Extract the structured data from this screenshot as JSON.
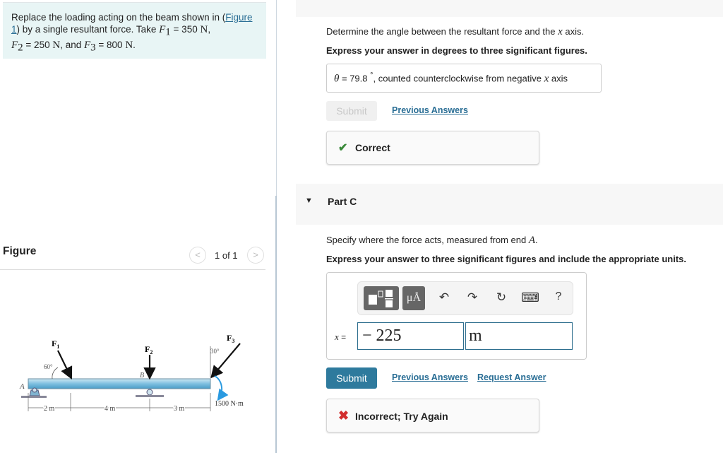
{
  "problem": {
    "text_1": "Replace the loading acting on the beam shown in (",
    "figure_link": "Figure 1",
    "text_2": ") by a single resultant force. Take ",
    "f1_sym": "F",
    "f1_sub": "1",
    "f1_val": " = 350 ",
    "f1_unit": "N",
    "sep1": ",",
    "f2_sym": "F",
    "f2_sub": "2",
    "f2_val": " = 250 ",
    "f2_unit": "N",
    "and": ", and ",
    "f3_sym": "F",
    "f3_sub": "3",
    "f3_val": " = 800 ",
    "f3_unit": "N",
    "end": "."
  },
  "figure": {
    "title": "Figure",
    "counter": "1 of 1",
    "prev_icon": "chevron-left-icon",
    "next_icon": "chevron-right-icon",
    "labels": {
      "f1": "F",
      "f1_sub": "1",
      "f2": "F",
      "f2_sub": "2",
      "f3": "F",
      "f3_sub": "3",
      "angle1": "60°",
      "angle3": "30°",
      "point_a": "A",
      "point_b": "B",
      "dim1": "2 m",
      "dim2": "4 m",
      "dim3": "3 m",
      "moment": "1500 N·m"
    }
  },
  "part_b": {
    "question_pre": "Determine the angle between the resultant force and the ",
    "question_var": "x",
    "question_post": " axis.",
    "instruction": "Express your answer in degrees to three significant figures.",
    "answer_var": "θ",
    "answer_eq": " = ",
    "answer_value": "79.8",
    "answer_deg": "°",
    "answer_suffix": ", counted counterclockwise from negative ",
    "answer_axis": "x",
    "answer_axis_post": " axis",
    "submit_label": "Submit",
    "previous_answers": "Previous Answers",
    "feedback": "Correct",
    "feedback_color": "#3a8a3a"
  },
  "part_c": {
    "label": "Part C",
    "question_pre": "Specify where the force acts, measured from end ",
    "question_var": "A",
    "question_post": ".",
    "instruction": "Express your answer to three significant figures and include the appropriate units.",
    "toolbar": {
      "templates": "templates-icon",
      "units": "μÅ",
      "undo": "↶",
      "redo": "↷",
      "reset": "↻",
      "keyboard": "⌨",
      "help": "?"
    },
    "var_label": "x",
    "var_eq": " = ",
    "value": "− 225",
    "unit": "m",
    "submit_label": "Submit",
    "previous_answers": "Previous Answers",
    "request_answer": "Request Answer",
    "feedback": "Incorrect; Try Again",
    "feedback_color": "#d22e2e",
    "submit_color": "#2e7a9d"
  }
}
